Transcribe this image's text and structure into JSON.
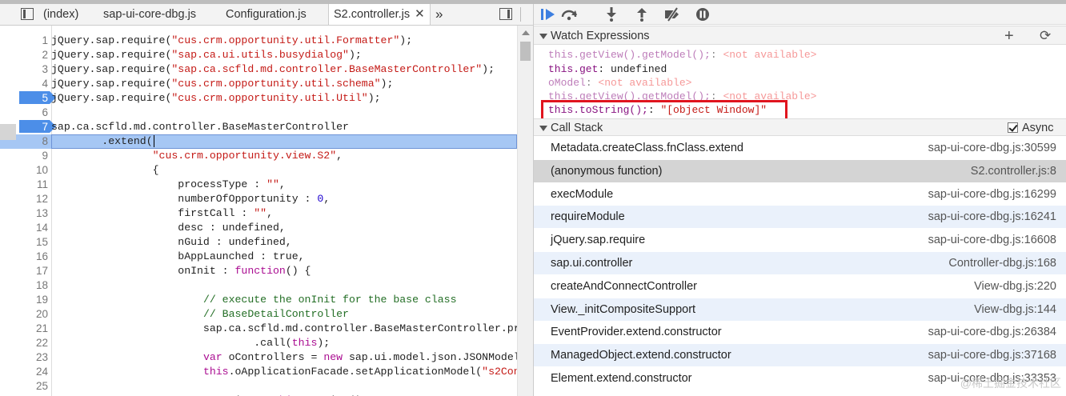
{
  "editor": {
    "tabs": [
      {
        "label": "(index)"
      },
      {
        "label": "sap-ui-core-dbg.js"
      },
      {
        "label": "Configuration.js"
      },
      {
        "label": "S2.controller.js",
        "close": "✕"
      }
    ],
    "overflow": "»",
    "line_numbers": [
      "1",
      "2",
      "3",
      "4",
      "5",
      "6",
      "7",
      "8",
      "9",
      "10",
      "11",
      "12",
      "13",
      "14",
      "15",
      "16",
      "17",
      "18",
      "19",
      "20",
      "21",
      "22",
      "23",
      "24",
      "25"
    ]
  },
  "watch": {
    "title": "Watch Expressions",
    "add_icon": "+",
    "refresh_icon": "⟳",
    "items": [
      {
        "expr": "this.getView().getModel();",
        "sep": ": ",
        "value": "<not available>"
      },
      {
        "expr": "this.get",
        "sep": ": ",
        "value": "undefined"
      },
      {
        "expr": "oModel",
        "sep": ": ",
        "value": "<not available>"
      },
      {
        "expr": "this.getView().getModel();",
        "sep": ": ",
        "value": "<not available>"
      },
      {
        "expr": "this.toString();",
        "sep": ": ",
        "value": "\"[object Window]\""
      }
    ],
    "highlight_color": "#e0141e"
  },
  "callstack": {
    "title": "Call Stack",
    "async_label": "Async",
    "frames": [
      {
        "name": "Metadata.createClass.fnClass.extend",
        "loc": "sap-ui-core-dbg.js:30599"
      },
      {
        "name": "(anonymous function)",
        "loc": "S2.controller.js:8"
      },
      {
        "name": "execModule",
        "loc": "sap-ui-core-dbg.js:16299"
      },
      {
        "name": "requireModule",
        "loc": "sap-ui-core-dbg.js:16241"
      },
      {
        "name": "jQuery.sap.require",
        "loc": "sap-ui-core-dbg.js:16608"
      },
      {
        "name": "sap.ui.controller",
        "loc": "Controller-dbg.js:168"
      },
      {
        "name": "createAndConnectController",
        "loc": "View-dbg.js:220"
      },
      {
        "name": "View._initCompositeSupport",
        "loc": "View-dbg.js:144"
      },
      {
        "name": "EventProvider.extend.constructor",
        "loc": "sap-ui-core-dbg.js:26384"
      },
      {
        "name": "ManagedObject.extend.constructor",
        "loc": "sap-ui-core-dbg.js:37168"
      },
      {
        "name": "Element.extend.constructor",
        "loc": "sap-ui-core-dbg.js:33353"
      }
    ]
  },
  "watermark": "@稀土掘金技术社区",
  "colors": {
    "breakpoint": "#4c8ee8",
    "current_line": "#a6c7f4",
    "resume": "#3d7fe0"
  }
}
